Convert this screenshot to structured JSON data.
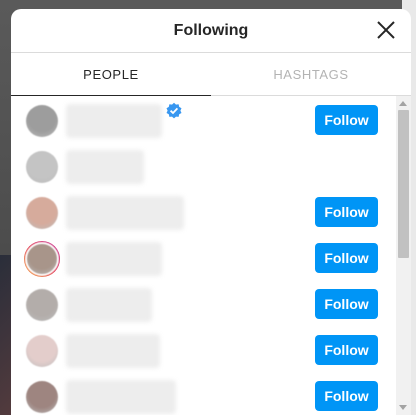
{
  "modal": {
    "title": "Following",
    "close_icon": "close-icon"
  },
  "tabs": [
    {
      "label": "PEOPLE",
      "active": true
    },
    {
      "label": "HASHTAGS",
      "active": false
    }
  ],
  "accounts": [
    {
      "verified": true,
      "show_follow": true,
      "story_ring": false,
      "avatar_color": "#9d9d9d",
      "follow_label": "Follow"
    },
    {
      "verified": false,
      "show_follow": false,
      "story_ring": false,
      "avatar_color": "#c4c4c4",
      "follow_label": ""
    },
    {
      "verified": false,
      "show_follow": true,
      "story_ring": false,
      "avatar_color": "#d6ab9c",
      "follow_label": "Follow"
    },
    {
      "verified": false,
      "show_follow": true,
      "story_ring": true,
      "avatar_color": "#a8958a",
      "follow_label": "Follow"
    },
    {
      "verified": false,
      "show_follow": true,
      "story_ring": false,
      "avatar_color": "#b3adaa",
      "follow_label": "Follow"
    },
    {
      "verified": false,
      "show_follow": true,
      "story_ring": false,
      "avatar_color": "#e3cdcb",
      "follow_label": "Follow"
    },
    {
      "verified": false,
      "show_follow": true,
      "story_ring": false,
      "avatar_color": "#9e8580",
      "follow_label": "Follow"
    }
  ],
  "colors": {
    "follow_button": "#0095f6",
    "verified_badge": "#3897f0",
    "story_ring": "#dc2743"
  }
}
